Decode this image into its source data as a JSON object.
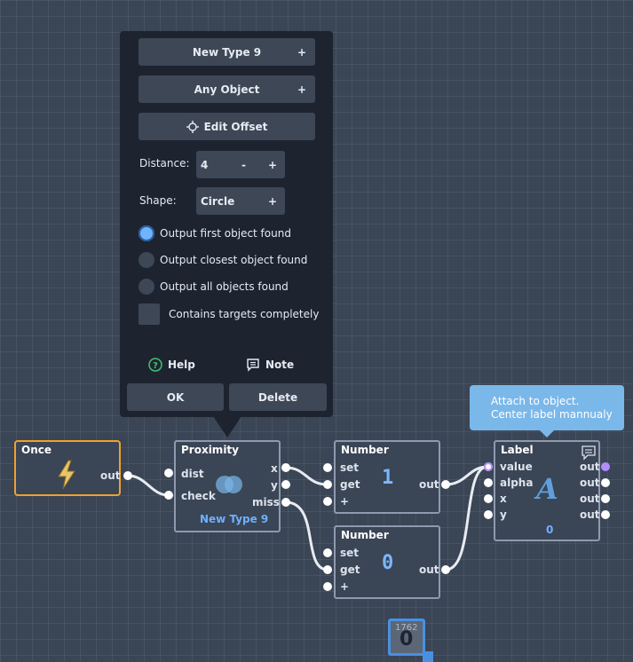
{
  "popup": {
    "type_button": "New Type 9",
    "object_button": "Any Object",
    "edit_offset_button": "Edit Offset",
    "plus": "+",
    "minus": "-",
    "distance_label": "Distance:",
    "distance_value": "4",
    "shape_label": "Shape:",
    "shape_value": "Circle",
    "options": [
      {
        "label": "Output first object found",
        "selected": true
      },
      {
        "label": "Output closest object found",
        "selected": false
      },
      {
        "label": "Output all objects found",
        "selected": false
      }
    ],
    "contains_label": "Contains targets completely",
    "contains_checked": false,
    "help_label": "Help",
    "note_label": "Note",
    "ok_label": "OK",
    "delete_label": "Delete"
  },
  "nodes": {
    "once": {
      "title": "Once",
      "out": "out",
      "icon": "lightning-icon"
    },
    "proximity": {
      "title": "Proximity",
      "in1": "dist",
      "in2": "check",
      "out1": "x",
      "out2": "y",
      "out3": "miss",
      "subtitle": "New Type 9",
      "icon": "overlap-circles-icon"
    },
    "number1": {
      "title": "Number",
      "set": "set",
      "get": "get",
      "plus": "+",
      "value": "1",
      "out": "out"
    },
    "number0": {
      "title": "Number",
      "set": "set",
      "get": "get",
      "plus": "+",
      "value": "0",
      "out": "out"
    },
    "label": {
      "title": "Label",
      "in1": "value",
      "in2": "alpha",
      "in3": "x",
      "in4": "y",
      "out1": "out",
      "out2": "out",
      "out3": "out",
      "out4": "out",
      "glyph": "A",
      "value": "0",
      "icon": "comment-icon"
    }
  },
  "tooltip": {
    "line1": "Attach to object.",
    "line2": "Center label mannualy"
  },
  "bottom_node": {
    "top_text": "1762",
    "value": "0"
  },
  "colors": {
    "accent_orange": "#f0a12c",
    "accent_blue": "#6fb4ff",
    "wire": "#ffffff",
    "purple_port": "#b48cff"
  }
}
